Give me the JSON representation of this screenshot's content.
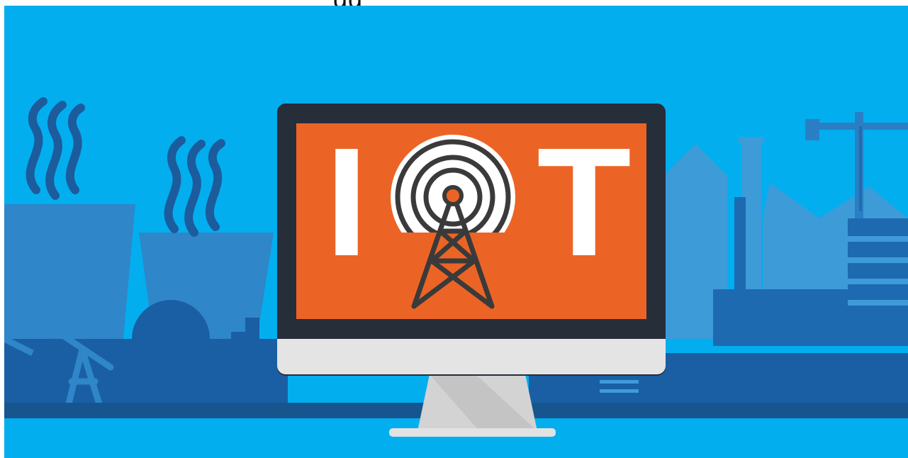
{
  "top_text": "gg",
  "screen": {
    "letter_left": "I",
    "letter_right": "T",
    "center_icon": "radio-tower-icon"
  },
  "colors": {
    "sky": "#03aeef",
    "skyline_mid": "#2f8fd0",
    "skyline_dark": "#1b63a6",
    "ground": "#175a9a",
    "screen_orange": "#ec6425",
    "bezel": "#262e3a",
    "monitor_chin": "#e6e6e6",
    "stand": "#d7d7d7"
  }
}
